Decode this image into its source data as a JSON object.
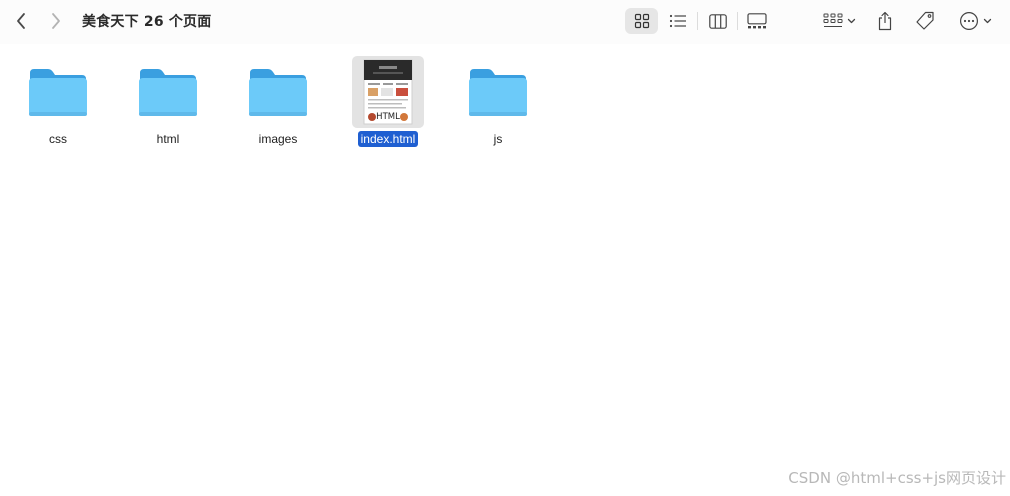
{
  "toolbar": {
    "title": "美食天下 26 个页面"
  },
  "files": [
    {
      "name": "css",
      "kind": "folder",
      "selected": false
    },
    {
      "name": "html",
      "kind": "folder",
      "selected": false
    },
    {
      "name": "images",
      "kind": "folder",
      "selected": false
    },
    {
      "name": "index.html",
      "kind": "html-document",
      "selected": true,
      "thumb_badge": "HTML"
    },
    {
      "name": "js",
      "kind": "folder",
      "selected": false
    }
  ],
  "watermark": "CSDN @html+css+js网页设计",
  "colors": {
    "folder_top": "#3a9fe0",
    "folder_body": "#6ccaf9",
    "selection": "#1f5fd1",
    "icon_selected_bg": "#e3e3e3"
  }
}
